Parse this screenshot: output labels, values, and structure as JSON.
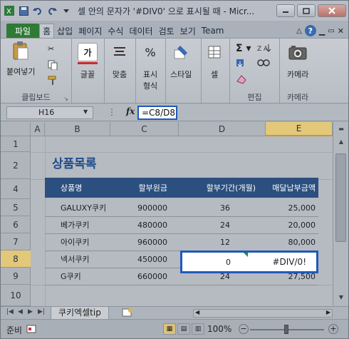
{
  "titlebar": {
    "title": "셀 안의 문자가 '#DIV0' 으로 표시될 때 - Micr...",
    "icons": [
      "excel-icon",
      "save-icon",
      "undo-icon",
      "redo-icon",
      "customize-icon"
    ]
  },
  "ribbon_tabs": [
    "파일",
    "홈",
    "삽입",
    "페이지",
    "수식",
    "데이터",
    "검토",
    "보기",
    "Team"
  ],
  "ribbon": {
    "paste": "붙여넣기",
    "clipboard": "클립보드",
    "font": "글꼴",
    "align": "맞춤",
    "number": "표시\n형식",
    "number_l1": "표시",
    "number_l2": "형식",
    "style": "스타일",
    "cells": "셀",
    "edit": "편집",
    "camera": "카메라",
    "camera_group": "카메라"
  },
  "formula_bar": {
    "name_box": "H16",
    "fx": "fx",
    "formula": "=C8/D8"
  },
  "columns": [
    "A",
    "B",
    "C",
    "D",
    "E"
  ],
  "rows": [
    "1",
    "2",
    "4",
    "5",
    "6",
    "7",
    "8",
    "9",
    "10"
  ],
  "sheet": {
    "title": "상품목록",
    "headers": [
      "상품명",
      "할부원금",
      "할부기간(개월)",
      "매달납부금액"
    ],
    "data": [
      [
        "GALUXY쿠키",
        "900000",
        "36",
        "25,000"
      ],
      [
        "베가쿠키",
        "480000",
        "24",
        "20,000"
      ],
      [
        "아이쿠키",
        "960000",
        "12",
        "80,000"
      ],
      [
        "넥서쿠키",
        "450000",
        "0",
        "#DIV/0!"
      ],
      [
        "G쿠키",
        "660000",
        "24",
        "27,500"
      ]
    ]
  },
  "sheet_tab": "쿠키엑셀tip",
  "status": {
    "ready": "준비",
    "zoom": "100%"
  }
}
